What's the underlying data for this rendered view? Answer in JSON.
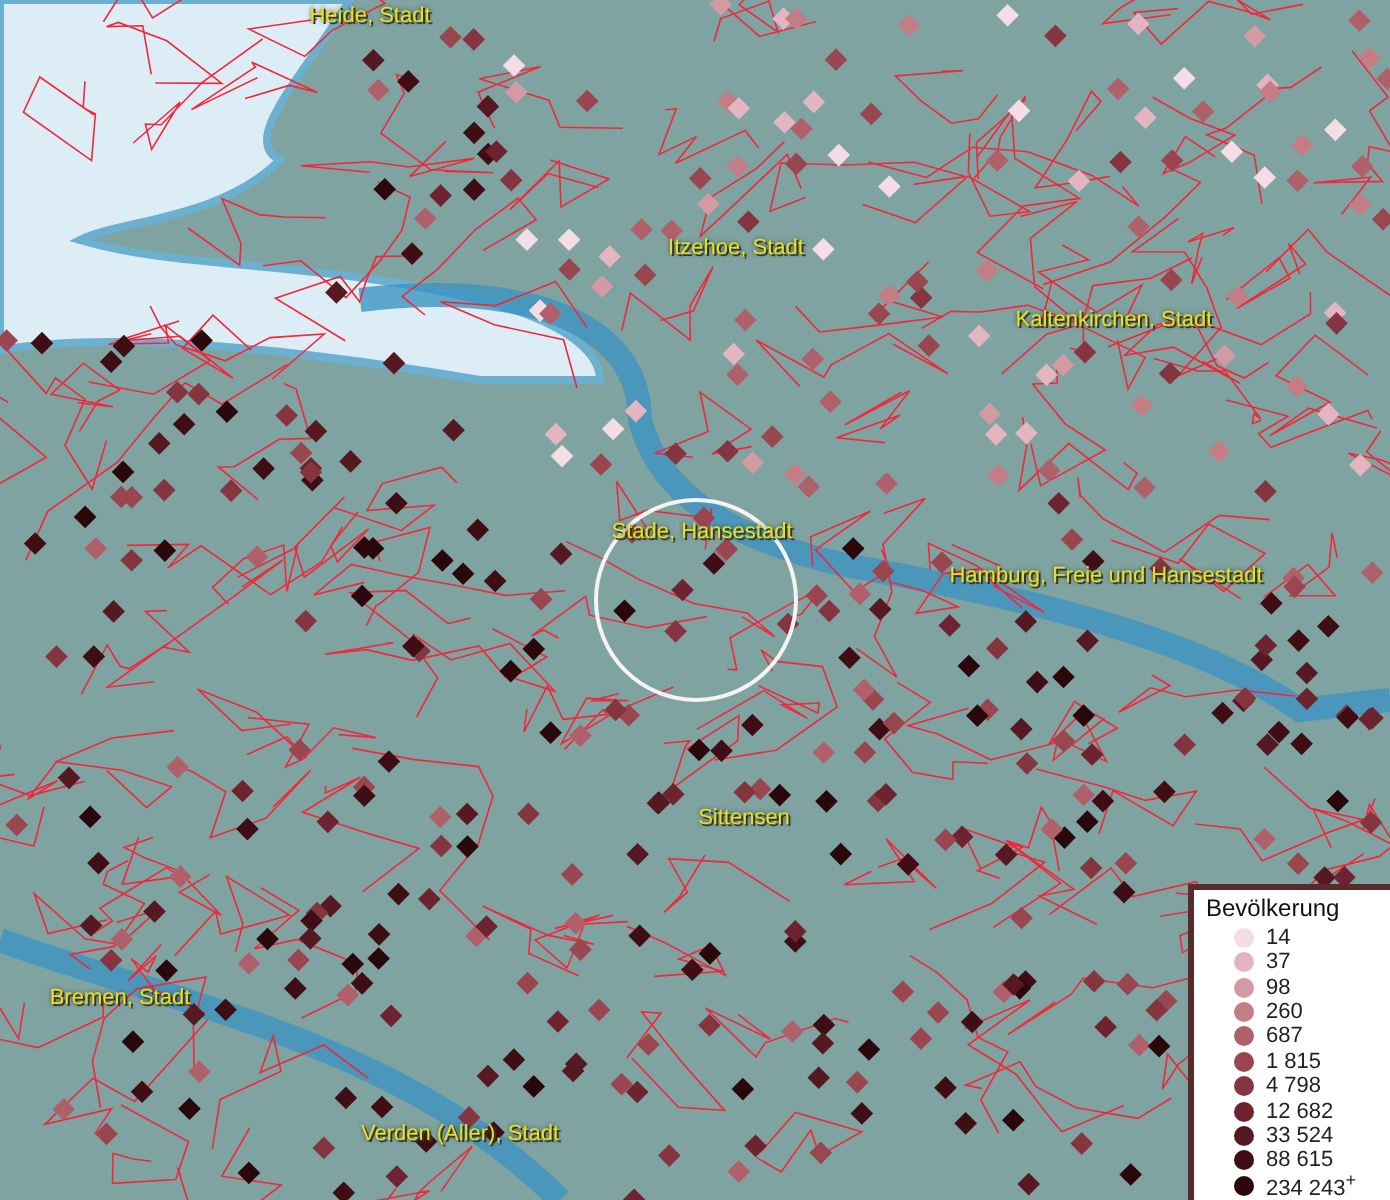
{
  "map": {
    "places": [
      {
        "name": "Heide, Stadt"
      },
      {
        "name": "Itzehoe, Stadt"
      },
      {
        "name": "Kaltenkirchen, Stadt"
      },
      {
        "name": "Stade, Hansestadt"
      },
      {
        "name": "Hamburg, Freie und Hansestadt"
      },
      {
        "name": "Sittensen"
      },
      {
        "name": "Bremen, Stadt"
      },
      {
        "name": "Verden (Aller), Stadt"
      }
    ]
  },
  "legend": {
    "title": "Bevölkerung",
    "items": [
      {
        "label": "14",
        "color": "#f5dde6"
      },
      {
        "label": "37",
        "color": "#e3b5c0"
      },
      {
        "label": "98",
        "color": "#d49aa3"
      },
      {
        "label": "260",
        "color": "#c47c85"
      },
      {
        "label": "687",
        "color": "#b0606a"
      },
      {
        "label": "1 815",
        "color": "#9a4650"
      },
      {
        "label": "4 798",
        "color": "#843540"
      },
      {
        "label": "12 682",
        "color": "#6e2430"
      },
      {
        "label": "33 524",
        "color": "#561821"
      },
      {
        "label": "88 615",
        "color": "#3f0e14"
      },
      {
        "label": "234 243$^{+}$",
        "color": "#2a070a"
      }
    ]
  }
}
